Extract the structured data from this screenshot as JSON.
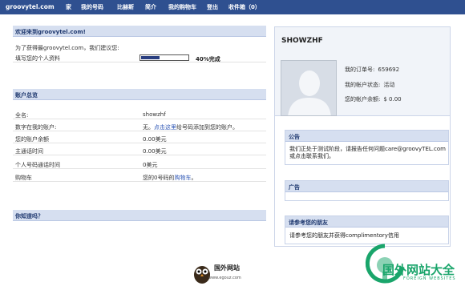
{
  "nav": {
    "brand": "groovytel.com",
    "items": [
      "家",
      "我的号码",
      "比赫斯",
      "简介",
      "我的购物车",
      "登出",
      "收件箱（0）"
    ]
  },
  "welcome": {
    "title": "欢迎来到groovytel.com!",
    "subtitle": "为了获得最groovytel.com，我们建议您:",
    "fill_profile_link": "填写您的个人资料",
    "progress_percent": 40,
    "progress_text": "40%完成"
  },
  "account": {
    "title": "账户总览",
    "rows": [
      {
        "label": "全名:",
        "value": "showzhf"
      },
      {
        "label": "数字在我的账户:",
        "value_prefix": "无。",
        "value_link": "点击这里",
        "value_suffix": "给号码添加到您的账户。"
      },
      {
        "label": "您的账户余额",
        "value": "0.00美元"
      },
      {
        "label": "主通话时间",
        "value": "0.00美元"
      },
      {
        "label": "个人号码通话时间",
        "value": "0美元"
      },
      {
        "label": "购物车",
        "value_prefix": "您的0号码的",
        "value_link": "购物车",
        "value_suffix": "。"
      }
    ]
  },
  "did_you_know": {
    "title": "你知道吗？"
  },
  "profile": {
    "name": "SHOWZHF",
    "order_label": "我的订单号:",
    "order_value": "659692",
    "status_label": "我的帐户状态:",
    "status_value": "活动",
    "balance_label": "您的帐户余额:",
    "balance_value": "$ 0.00"
  },
  "notice": {
    "title": "公告",
    "line1": "我们正处于测试阶段，请报告任何问题care@groovyTEL.com",
    "line2": "或点击联系我们。"
  },
  "ads": {
    "title": "广告"
  },
  "friends": {
    "title": "请参考您的朋友",
    "text": "请参考您的朋友并获得complimentory信用"
  },
  "footer": {
    "site_name": "国外网站",
    "site_url": "www.egouz.com"
  },
  "watermark": {
    "title": "国外网站大全",
    "subtitle": "FOREIGN WEBSITES"
  },
  "colors": {
    "nav_bg": "#2f5090",
    "section_bg": "#d6dff0",
    "link": "#2d56b5",
    "watermark": "#1aa56b"
  }
}
